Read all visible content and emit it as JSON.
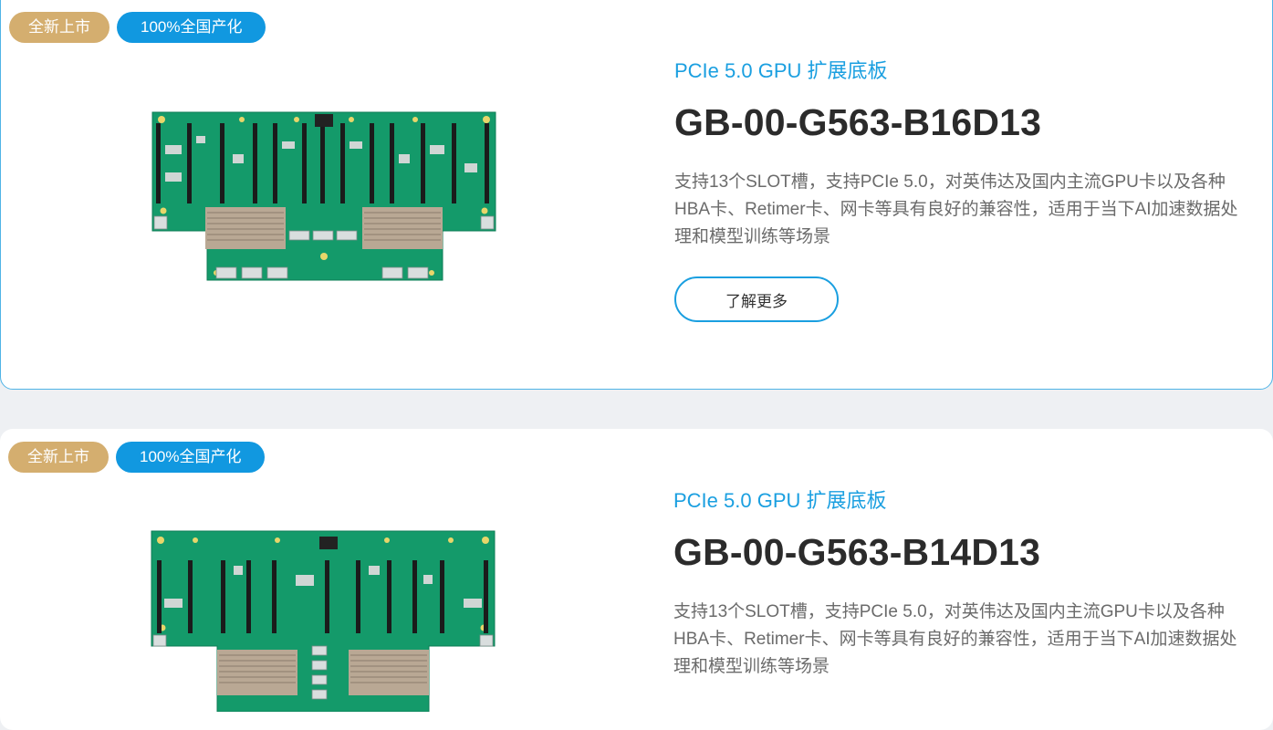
{
  "products": [
    {
      "badges": [
        "全新上市",
        "100%全国产化"
      ],
      "category": "PCIe 5.0 GPU 扩展底板",
      "model": "GB-00-G563-B16D13",
      "description": "支持13个SLOT槽，支持PCIe 5.0，对英伟达及国内主流GPU卡以及各种HBA卡、Retimer卡、网卡等具有良好的兼容性，适用于当下AI加速数据处理和模型训练等场景",
      "button_label": "了解更多"
    },
    {
      "badges": [
        "全新上市",
        "100%全国产化"
      ],
      "category": "PCIe 5.0 GPU 扩展底板",
      "model": "GB-00-G563-B14D13",
      "description": "支持13个SLOT槽，支持PCIe 5.0，对英伟达及国内主流GPU卡以及各种HBA卡、Retimer卡、网卡等具有良好的兼容性，适用于当下AI加速数据处理和模型训练等场景"
    }
  ],
  "colors": {
    "accent_blue": "#1a9fe0",
    "badge_gold": "#d4ae6f",
    "badge_blue": "#1198e0",
    "pcb_green": "#149a6a"
  }
}
